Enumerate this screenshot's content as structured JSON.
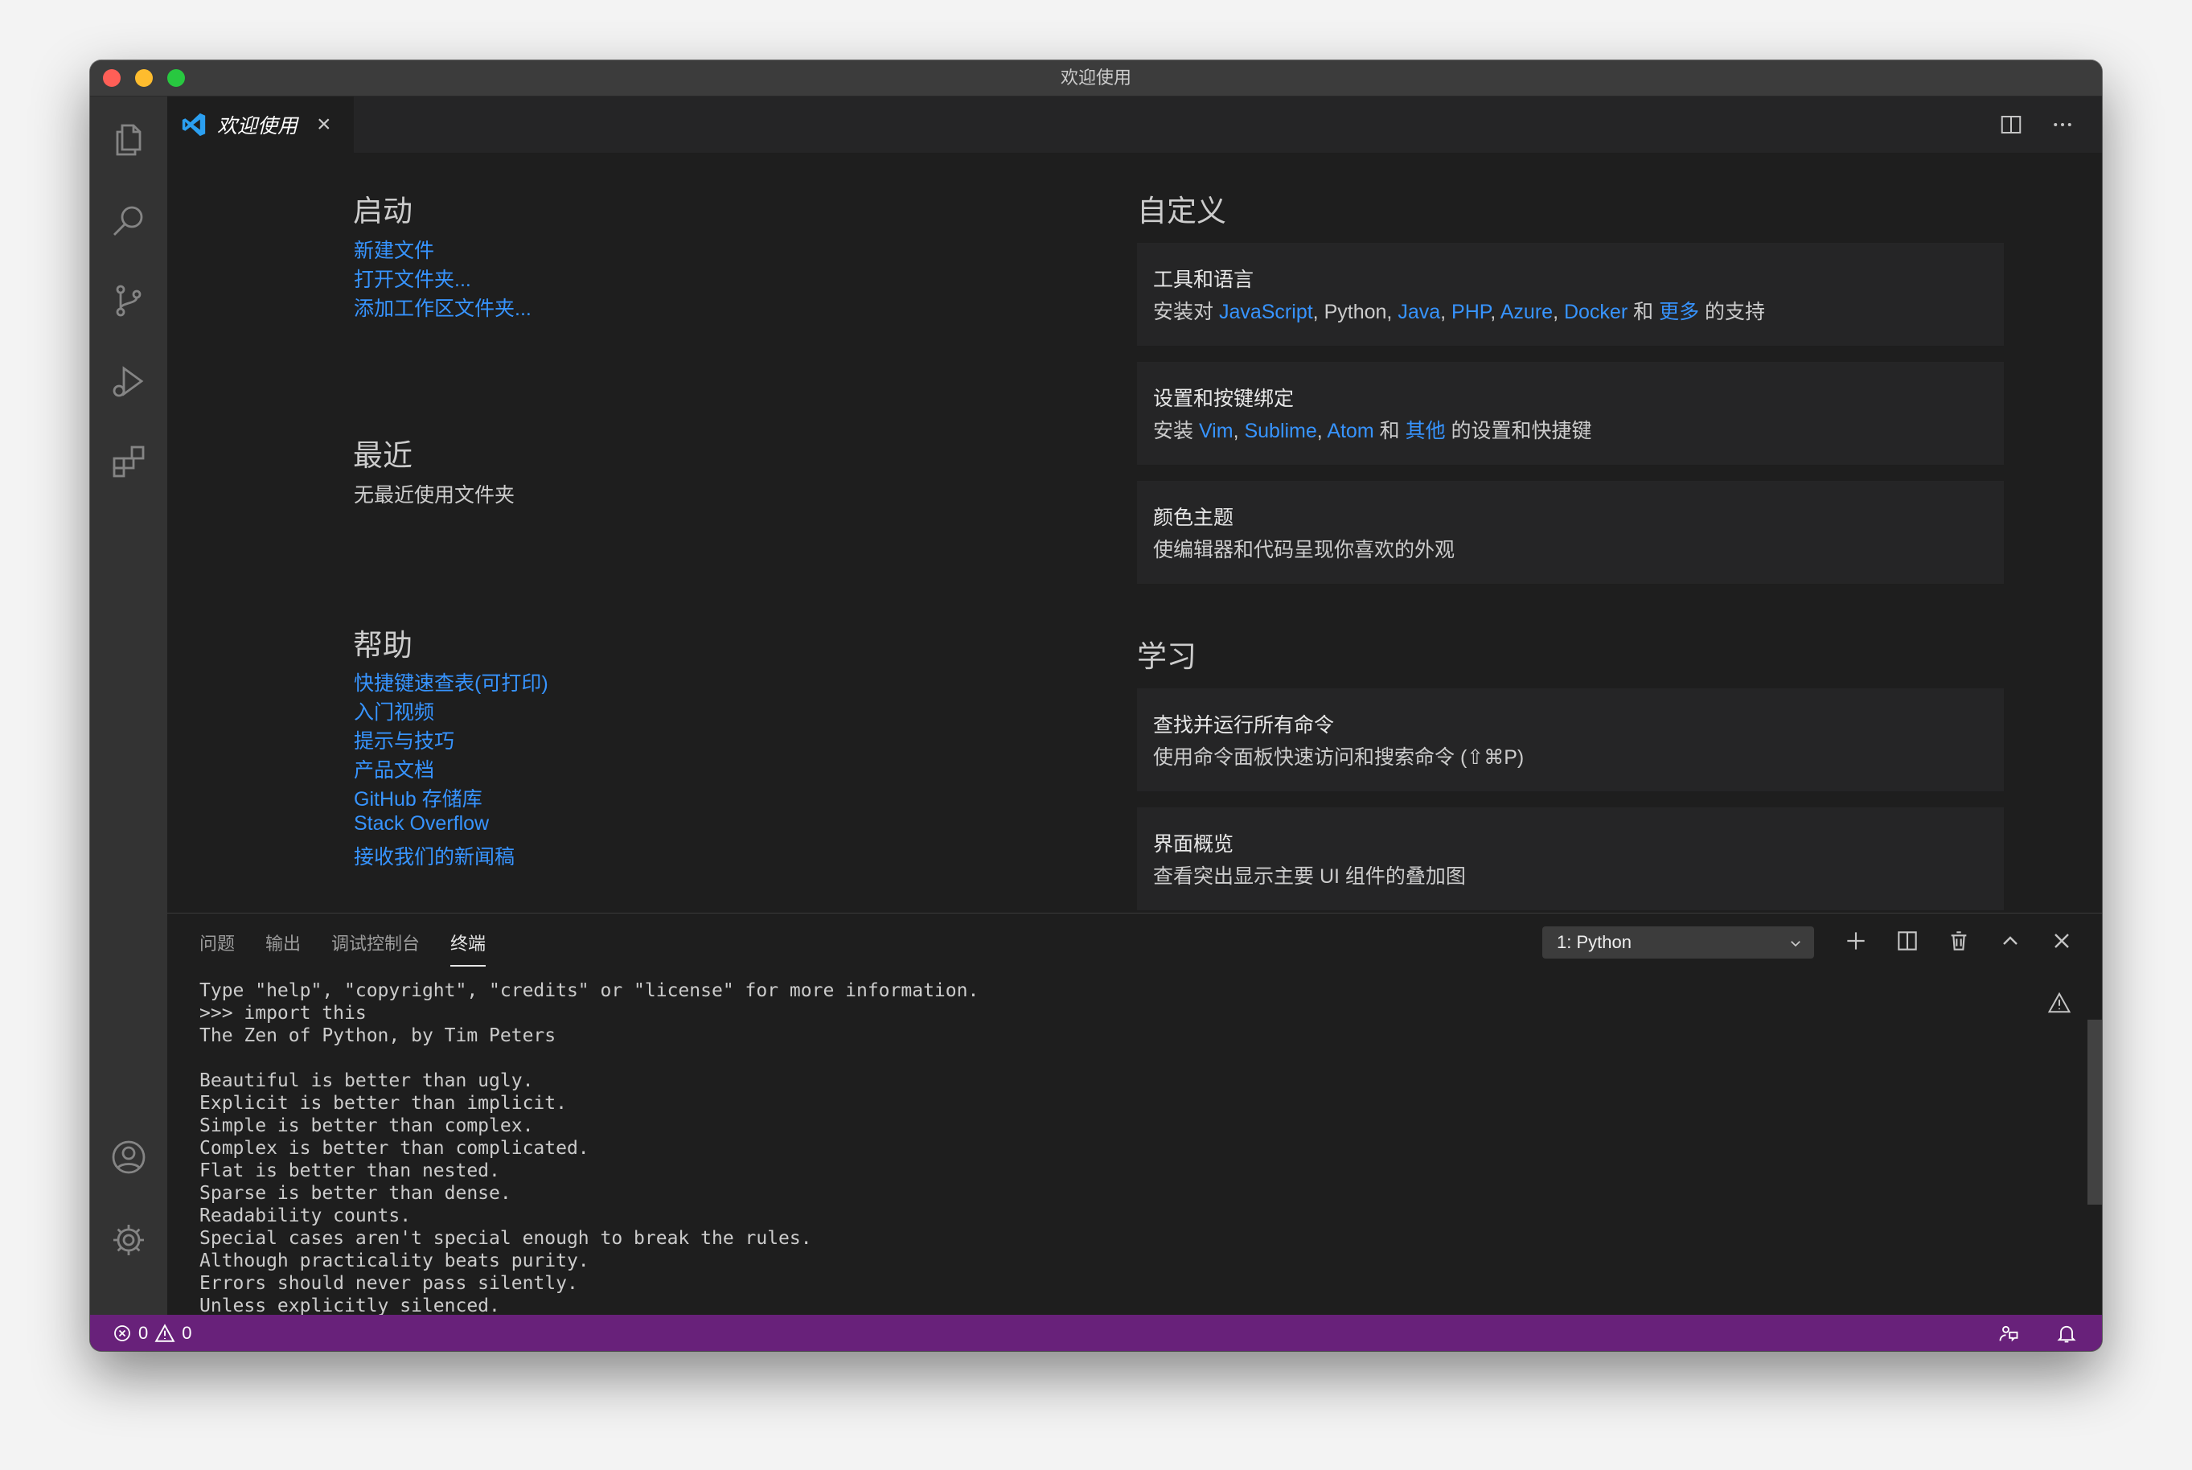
{
  "window": {
    "title": "欢迎使用"
  },
  "tab": {
    "title": "欢迎使用",
    "close": "×"
  },
  "start": {
    "title": "启动",
    "links": [
      "新建文件",
      "打开文件夹...",
      "添加工作区文件夹..."
    ]
  },
  "recent": {
    "title": "最近",
    "empty": "无最近使用文件夹"
  },
  "help": {
    "title": "帮助",
    "links": [
      "快捷键速查表(可打印)",
      "入门视频",
      "提示与技巧",
      "产品文档",
      "GitHub 存储库",
      "Stack Overflow",
      "接收我们的新闻稿"
    ]
  },
  "customize": {
    "title": "自定义",
    "tools": {
      "title": "工具和语言",
      "prefix": "安装对 ",
      "items": [
        "JavaScript",
        "Python",
        "Java",
        "PHP",
        "Azure",
        "Docker"
      ],
      "and": " 和 ",
      "more": "更多",
      "suffix": " 的支持"
    },
    "keymap": {
      "title": "设置和按键绑定",
      "prefix": "安装 ",
      "items": [
        "Vim",
        "Sublime",
        "Atom"
      ],
      "and": " 和 ",
      "more": "其他",
      "suffix": " 的设置和快捷键"
    },
    "theme": {
      "title": "颜色主题",
      "desc": "使编辑器和代码呈现你喜欢的外观"
    }
  },
  "learn": {
    "title": "学习",
    "commands": {
      "title": "查找并运行所有命令",
      "desc": "使用命令面板快速访问和搜索命令 (⇧⌘P)"
    },
    "overview": {
      "title": "界面概览",
      "desc": "查看突出显示主要 UI 组件的叠加图"
    }
  },
  "panel": {
    "tabs": [
      "问题",
      "输出",
      "调试控制台",
      "终端"
    ],
    "active_tab": 3,
    "terminal_select": "1: Python",
    "terminal_lines": [
      "Type \"help\", \"copyright\", \"credits\" or \"license\" for more information.",
      ">>> import this",
      "The Zen of Python, by Tim Peters",
      "",
      "Beautiful is better than ugly.",
      "Explicit is better than implicit.",
      "Simple is better than complex.",
      "Complex is better than complicated.",
      "Flat is better than nested.",
      "Sparse is better than dense.",
      "Readability counts.",
      "Special cases aren't special enough to break the rules.",
      "Although practicality beats purity.",
      "Errors should never pass silently.",
      "Unless explicitly silenced."
    ]
  },
  "status": {
    "errors": "0",
    "warnings": "0"
  },
  "colors": {
    "accent": "#3794ff",
    "statusbar": "#68217a",
    "background": "#1e1e1e"
  }
}
